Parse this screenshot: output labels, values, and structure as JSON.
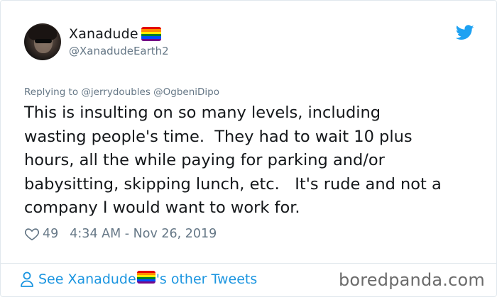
{
  "author": {
    "display_name": "Xanadude",
    "handle": "@XanadudeEarth2",
    "flag_icon": "rainbow-flag-emoji"
  },
  "reply": {
    "prefix": "Replying to",
    "mentions": "@jerrydoubles @OgbeniDipo"
  },
  "tweet": {
    "text": "This is insulting on so many levels, including\nwasting people's time.  They had to wait 10 plus\nhours, all the while paying for parking and/or\nbabysitting, skipping lunch, etc.   It's rude and not a\ncompany I would want to work for.",
    "likes": "49",
    "timestamp": "4:34 AM - Nov 26, 2019"
  },
  "footer": {
    "link_prefix": "See Xanadude",
    "link_suffix": "'s other Tweets"
  },
  "watermark": "boredpanda.com",
  "colors": {
    "twitter_blue": "#1da1f2",
    "link_blue": "#1b95e0",
    "muted_gray": "#657786",
    "rainbow": [
      "#e40303",
      "#ff8c00",
      "#ffed00",
      "#008026",
      "#004dff",
      "#750787"
    ]
  }
}
